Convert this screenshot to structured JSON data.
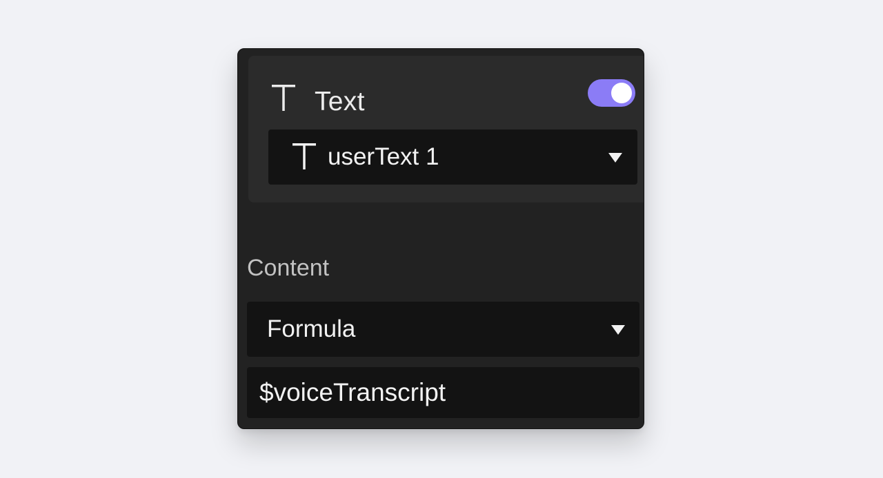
{
  "layer": {
    "icon": "text-type-icon",
    "title": "Text",
    "enabled": true,
    "toggle_color": "#8b7cf6",
    "selected_layer": {
      "icon": "text-type-icon",
      "label": "userText 1"
    }
  },
  "content": {
    "label": "Content",
    "mode": "Formula",
    "formula": "$voiceTranscript"
  }
}
